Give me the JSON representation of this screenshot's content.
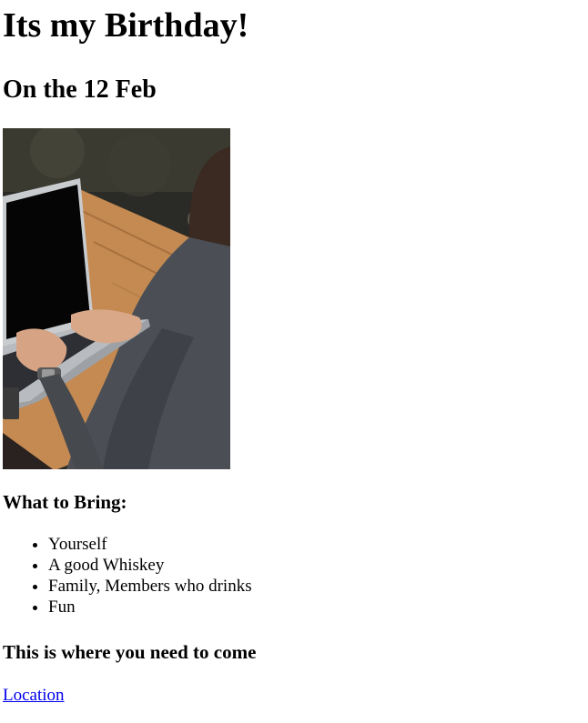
{
  "page": {
    "title": "Its my Birthday!",
    "date_heading": "On the 12 Feb",
    "bring_heading": "What to Bring:",
    "bring_items": [
      "Yourself",
      "A good Whiskey",
      "Family, Members who drinks",
      "Fun"
    ],
    "where_heading": "This is where you need to come",
    "location_link": "Location"
  },
  "image": {
    "subject": "person typing on a laptop at a wooden table with a coffee cup"
  }
}
